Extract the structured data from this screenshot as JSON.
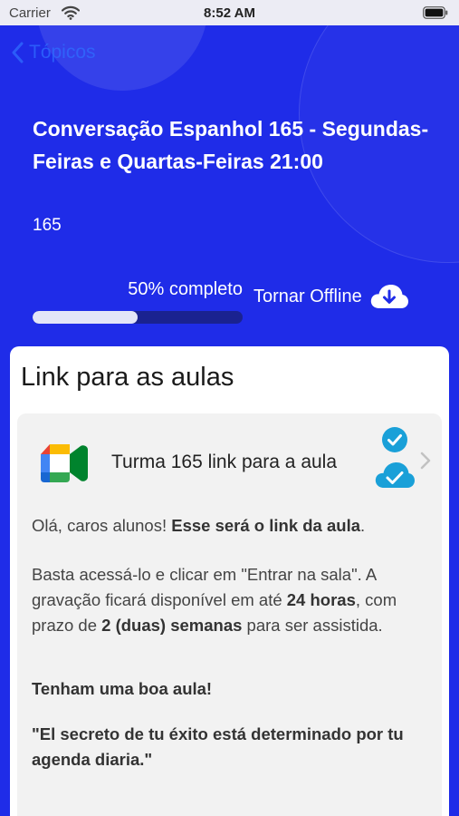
{
  "status_bar": {
    "carrier": "Carrier",
    "time": "8:52 AM"
  },
  "nav": {
    "back_label": "Tópicos"
  },
  "course": {
    "title": "Conversação Espanhol 165 - Segundas-Feiras e Quartas-Feiras 21:00",
    "subtitle": "165"
  },
  "progress": {
    "label": "50% completo",
    "fraction": 0.5
  },
  "offline": {
    "label": "Tornar Offline"
  },
  "section": {
    "title": "Link para as aulas"
  },
  "link_item": {
    "label": "Turma 165 link para a aula"
  },
  "message": {
    "p1_plain": "Olá, caros alunos! ",
    "p1_bold": "Esse será o link da aula",
    "p1_end": ".",
    "p2_a": "Basta acessá-lo e clicar em \"Entrar na sala\". A gravação ficará disponível em até ",
    "p2_b": "24 horas",
    "p2_c": ", com prazo de ",
    "p2_d": "2 (duas) semanas",
    "p2_e": " para ser assistida.",
    "p3": "Tenham uma boa aula!",
    "p4": "\"El secreto de tu éxito está determinado por tu agenda diaria.\""
  },
  "colors": {
    "primary": "#1f2ce8",
    "accent": "#2f6dff",
    "check": "#1aa0d8"
  },
  "icons": [
    "wifi-icon",
    "battery-icon",
    "chevron-left-icon",
    "cloud-download-icon",
    "google-meet-icon",
    "check-circle-icon",
    "cloud-check-icon",
    "chevron-right-icon"
  ]
}
